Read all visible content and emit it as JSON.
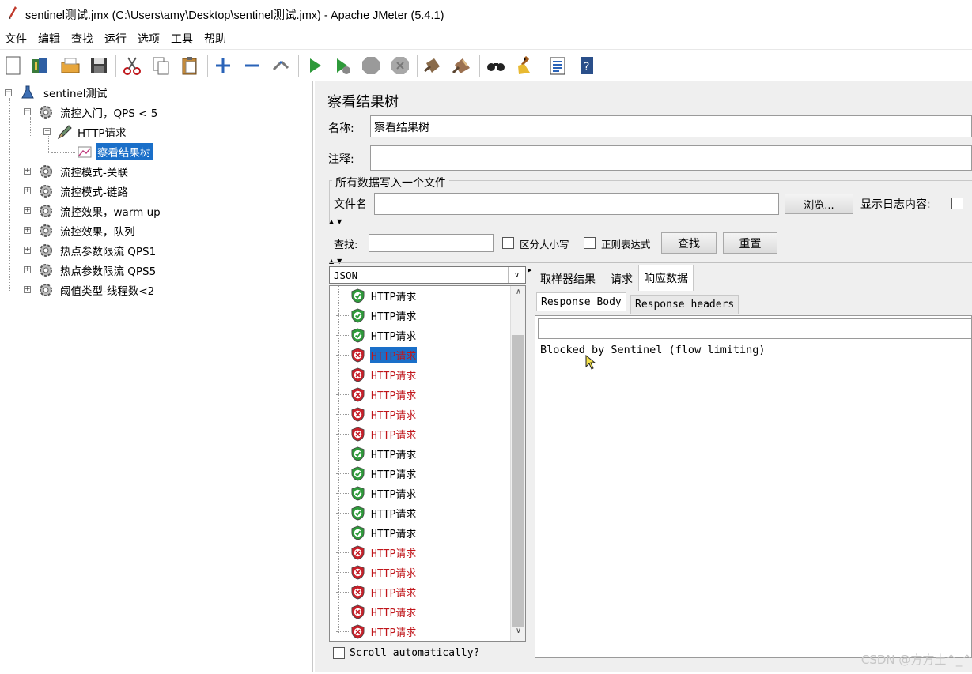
{
  "window": {
    "title": "sentinel测试.jmx (C:\\Users\\amy\\Desktop\\sentinel测试.jmx) - Apache JMeter (5.4.1)"
  },
  "menu": [
    "文件",
    "编辑",
    "查找",
    "运行",
    "选项",
    "工具",
    "帮助"
  ],
  "toolbar_icons": [
    "new-icon",
    "templates-icon",
    "open-icon",
    "save-icon",
    "cut-icon",
    "copy-icon",
    "paste-icon",
    "expand-icon",
    "collapse-icon",
    "toggle-icon",
    "start-icon",
    "start-no-pause-icon",
    "stop-icon",
    "shutdown-icon",
    "clear-icon",
    "clear-all-icon",
    "search-icon",
    "reset-search-icon",
    "function-helper-icon",
    "help-icon"
  ],
  "tree": {
    "root": "sentinel测试",
    "groups": [
      {
        "label": "流控入门，QPS < 5",
        "expanded": true
      },
      {
        "label": "流控模式-关联",
        "expanded": false
      },
      {
        "label": "流控模式-链路",
        "expanded": false
      },
      {
        "label": "流控效果，warm up",
        "expanded": false
      },
      {
        "label": "流控效果，队列",
        "expanded": false
      },
      {
        "label": "热点参数限流 QPS1",
        "expanded": false
      },
      {
        "label": "热点参数限流 QPS5",
        "expanded": false
      },
      {
        "label": "阈值类型-线程数<2",
        "expanded": false
      }
    ],
    "sampler": "HTTP请求",
    "listener": "察看结果树"
  },
  "panel": {
    "title": "察看结果树",
    "name_label": "名称:",
    "name_value": "察看结果树",
    "comment_label": "注释:",
    "comment_value": "",
    "file_group_title": "所有数据写入一个文件",
    "filename_label": "文件名",
    "filename_value": "",
    "browse_button": "浏览...",
    "log_content_label": "显示日志内容:",
    "search_label": "查找:",
    "search_value": "",
    "case_sensitive_label": "区分大小写",
    "regex_label": "正则表达式",
    "find_button": "查找",
    "reset_button": "重置"
  },
  "results": {
    "renderer": "JSON",
    "items": [
      {
        "label": "HTTP请求",
        "status": "success"
      },
      {
        "label": "HTTP请求",
        "status": "success"
      },
      {
        "label": "HTTP请求",
        "status": "success"
      },
      {
        "label": "HTTP请求",
        "status": "fail",
        "selected": true
      },
      {
        "label": "HTTP请求",
        "status": "fail"
      },
      {
        "label": "HTTP请求",
        "status": "fail"
      },
      {
        "label": "HTTP请求",
        "status": "fail"
      },
      {
        "label": "HTTP请求",
        "status": "fail"
      },
      {
        "label": "HTTP请求",
        "status": "success"
      },
      {
        "label": "HTTP请求",
        "status": "success"
      },
      {
        "label": "HTTP请求",
        "status": "success"
      },
      {
        "label": "HTTP请求",
        "status": "success"
      },
      {
        "label": "HTTP请求",
        "status": "success"
      },
      {
        "label": "HTTP请求",
        "status": "fail"
      },
      {
        "label": "HTTP请求",
        "status": "fail"
      },
      {
        "label": "HTTP请求",
        "status": "fail"
      },
      {
        "label": "HTTP请求",
        "status": "fail"
      },
      {
        "label": "HTTP请求",
        "status": "fail"
      }
    ],
    "scroll_auto_label": "Scroll automatically?"
  },
  "detail": {
    "tabs": [
      "取样器结果",
      "请求",
      "响应数据"
    ],
    "active_tab": "响应数据",
    "subtabs": [
      "Response Body",
      "Response headers"
    ],
    "active_subtab": "Response Body",
    "body": "Blocked by Sentinel (flow limiting)"
  },
  "watermark": "CSDN @方方土^_^",
  "colors": {
    "selection": "#1a6fc9",
    "fail_text": "#c0161b",
    "success_shield": "#2e9a3a",
    "fail_shield": "#c8202a",
    "panel_bg": "#efefef"
  }
}
